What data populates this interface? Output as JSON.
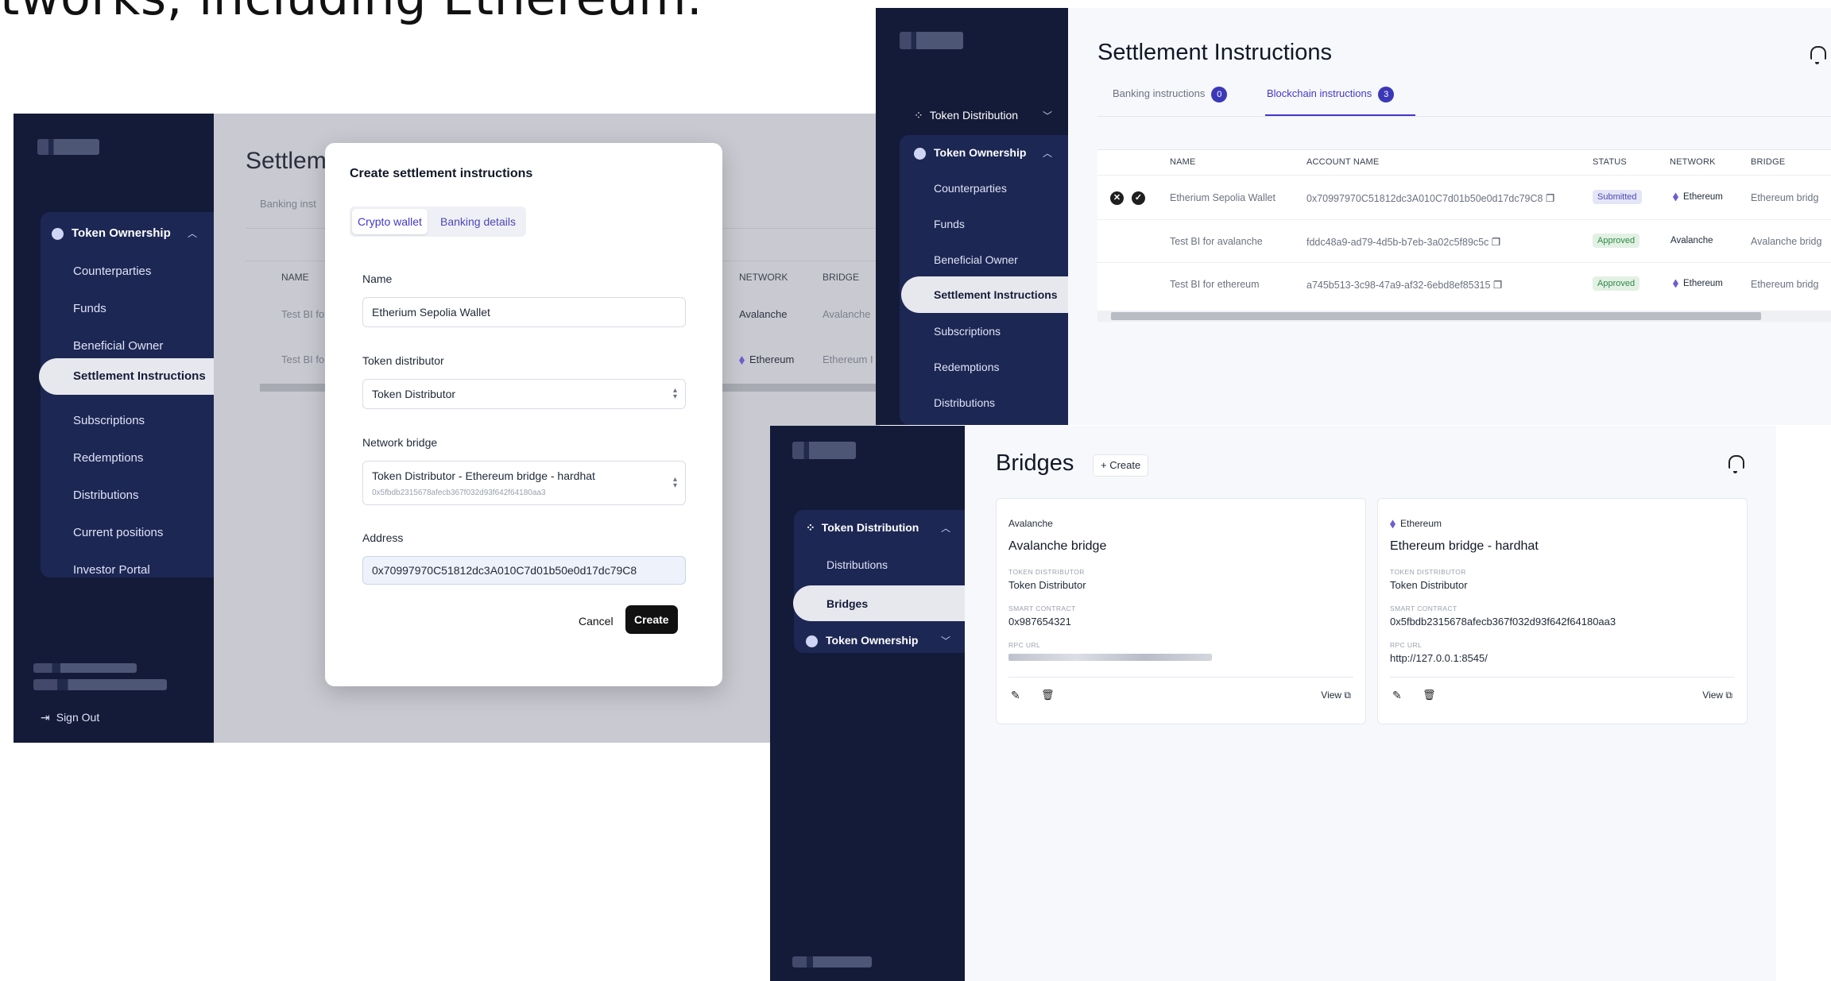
{
  "headline": "tworks, including Ethereum.",
  "left": {
    "sidebar": {
      "group_title": "Token Ownership",
      "items": [
        "Counterparties",
        "Funds",
        "Beneficial Owner",
        "Settlement Instructions",
        "Subscriptions",
        "Redemptions",
        "Distributions",
        "Current positions",
        "Investor Portal"
      ],
      "active_item": "Settlement Instructions",
      "sign_out": "Sign Out"
    },
    "background": {
      "title": "Settlem",
      "tab": "Banking inst",
      "col_name": "NAME",
      "col_network": "NETWORK",
      "col_bridge": "BRIDGE",
      "row1_name": "Test BI fo",
      "row1_network": "Avalanche",
      "row1_bridge": "Avalanche",
      "row2_name": "Test BI fo",
      "row2_network": "Ethereum",
      "row2_bridge": "Ethereum I"
    },
    "modal": {
      "title": "Create settlement instructions",
      "tab_crypto": "Crypto wallet",
      "tab_banking": "Banking details",
      "name_label": "Name",
      "name_value": "Etherium Sepolia Wallet",
      "distributor_label": "Token distributor",
      "distributor_value": "Token Distributor",
      "bridge_label": "Network bridge",
      "bridge_value": "Token Distributor - Ethereum bridge - hardhat",
      "bridge_sub": "0x5fbdb2315678afecb367f032d93f642f64180aa3",
      "address_label": "Address",
      "address_value": "0x70997970C51812dc3A010C7d01b50e0d17dc79C8",
      "cancel": "Cancel",
      "create": "Create"
    }
  },
  "settlement": {
    "sidebar": {
      "token_distribution": "Token Distribution",
      "token_ownership": "Token Ownership",
      "items": [
        "Counterparties",
        "Funds",
        "Beneficial Owner",
        "Settlement Instructions",
        "Subscriptions",
        "Redemptions",
        "Distributions"
      ],
      "active_item": "Settlement Instructions"
    },
    "title": "Settlement Instructions",
    "tabs": [
      {
        "label": "Banking instructions",
        "count": "0"
      },
      {
        "label": "Blockchain instructions",
        "count": "3"
      }
    ],
    "columns": [
      "NAME",
      "ACCOUNT NAME",
      "STATUS",
      "NETWORK",
      "BRIDGE"
    ],
    "rows": [
      {
        "name": "Etherium Sepolia Wallet",
        "account": "0x70997970C51812dc3A010C7d01b50e0d17dc79C8",
        "status": "Submitted",
        "network": "Ethereum",
        "bridge": "Ethereum bridg"
      },
      {
        "name": "Test BI for avalanche",
        "account": "fddc48a9-ad79-4d5b-b7eb-3a02c5f89c5c",
        "status": "Approved",
        "network": "Avalanche",
        "bridge": "Avalanche bridg"
      },
      {
        "name": "Test BI for ethereum",
        "account": "a745b513-3c98-47a9-af32-6ebd8ef85315",
        "status": "Approved",
        "network": "Ethereum",
        "bridge": "Ethereum bridg"
      }
    ]
  },
  "bridges": {
    "sidebar": {
      "token_distribution": "Token Distribution",
      "distributions": "Distributions",
      "bridges": "Bridges",
      "token_ownership": "Token Ownership"
    },
    "title": "Bridges",
    "create": "+ Create",
    "cards": [
      {
        "network": "Avalanche",
        "name": "Avalanche bridge",
        "dist_label": "TOKEN DISTRIBUTOR",
        "dist": "Token Distributor",
        "sc_label": "SMART CONTRACT",
        "sc": "0x987654321",
        "rpc_label": "RPC URL",
        "rpc": "",
        "view": "View"
      },
      {
        "network": "Ethereum",
        "name": "Ethereum bridge - hardhat",
        "dist_label": "TOKEN DISTRIBUTOR",
        "dist": "Token Distributor",
        "sc_label": "SMART CONTRACT",
        "sc": "0x5fbdb2315678afecb367f032d93f642f64180aa3",
        "rpc_label": "RPC URL",
        "rpc": "http://127.0.0.1:8545/",
        "view": "View"
      }
    ]
  },
  "colors": {
    "sidebar": "#141b38",
    "accent": "#3b38b8",
    "approved": "#2f8a45",
    "submitted": "#4f46b5"
  },
  "icons": [
    "bell-icon",
    "copy-icon",
    "ethereum-icon",
    "edit-icon",
    "trash-icon",
    "external-link-icon",
    "sign-out-icon",
    "chevron-up-icon",
    "chevron-down-icon",
    "close-circle-icon",
    "check-circle-icon"
  ]
}
